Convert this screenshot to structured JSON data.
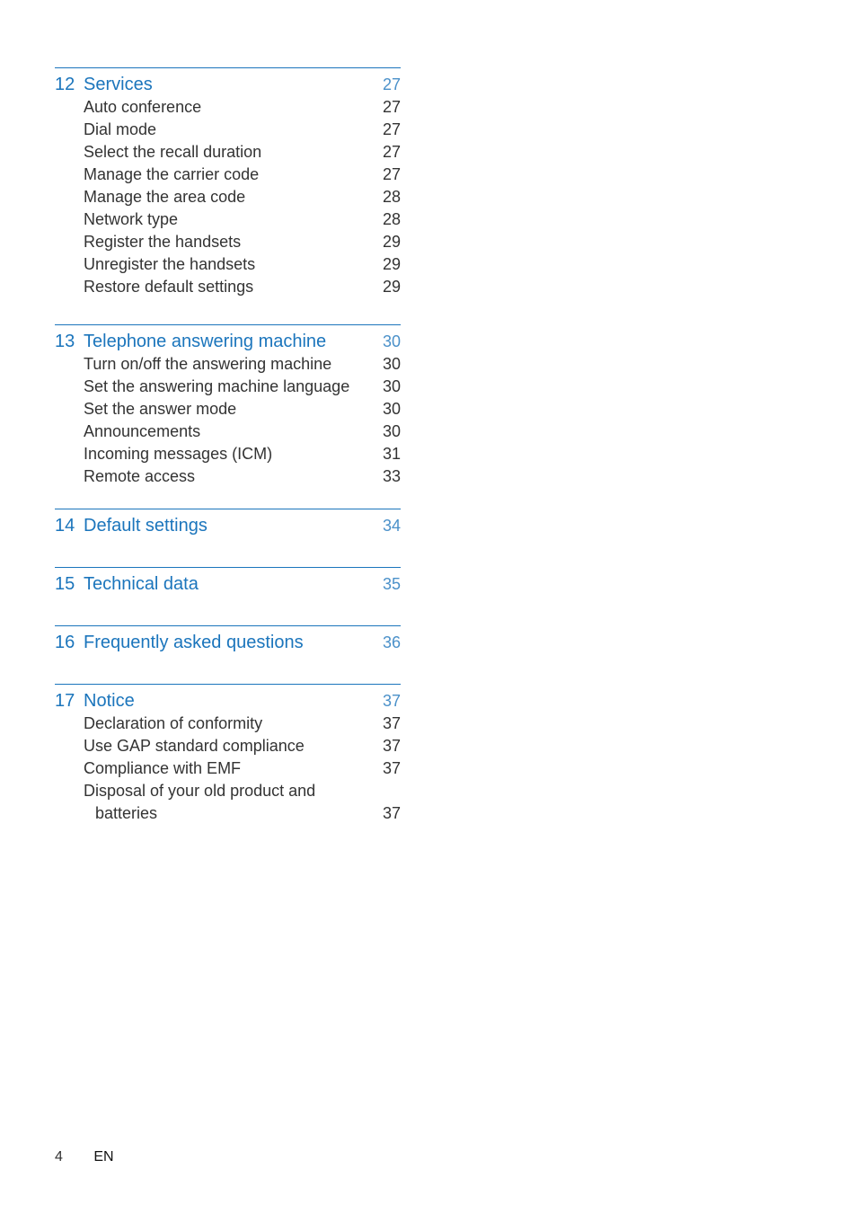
{
  "sections": [
    {
      "num": "12",
      "title": "Services",
      "page": "27",
      "items": [
        {
          "label": "Auto conference",
          "page": "27"
        },
        {
          "label": "Dial mode",
          "page": "27"
        },
        {
          "label": "Select the recall duration",
          "page": "27"
        },
        {
          "label": "Manage the carrier code",
          "page": "27"
        },
        {
          "label": "Manage the area code",
          "page": "28"
        },
        {
          "label": "Network type",
          "page": "28"
        },
        {
          "label": "Register the handsets",
          "page": "29"
        },
        {
          "label": "Unregister the handsets",
          "page": "29"
        },
        {
          "label": "Restore default settings",
          "page": "29"
        }
      ]
    },
    {
      "num": "13",
      "title": "Telephone answering machine",
      "page": "30",
      "items": [
        {
          "label": "Turn on/off the answering machine",
          "page": "30"
        },
        {
          "label": "Set the answering machine language",
          "page": "30"
        },
        {
          "label": "Set the answer mode",
          "page": "30"
        },
        {
          "label": "Announcements",
          "page": "30"
        },
        {
          "label": "Incoming messages (ICM)",
          "page": "31"
        },
        {
          "label": "Remote access",
          "page": "33"
        }
      ]
    },
    {
      "num": "14",
      "title": "Default settings",
      "page": "34",
      "items": []
    },
    {
      "num": "15",
      "title": "Technical data",
      "page": "35",
      "items": []
    },
    {
      "num": "16",
      "title": "Frequently asked questions",
      "page": "36",
      "items": []
    },
    {
      "num": "17",
      "title": "Notice",
      "page": "37",
      "items": [
        {
          "label": "Declaration of conformity",
          "page": "37"
        },
        {
          "label": "Use GAP standard compliance",
          "page": "37"
        },
        {
          "label": "Compliance with EMF",
          "page": "37"
        },
        {
          "label": "Disposal of your old product and",
          "page": ""
        },
        {
          "label": "batteries",
          "page": "37",
          "cont": true
        }
      ]
    }
  ],
  "footer": {
    "page_number": "4",
    "language": "EN"
  }
}
